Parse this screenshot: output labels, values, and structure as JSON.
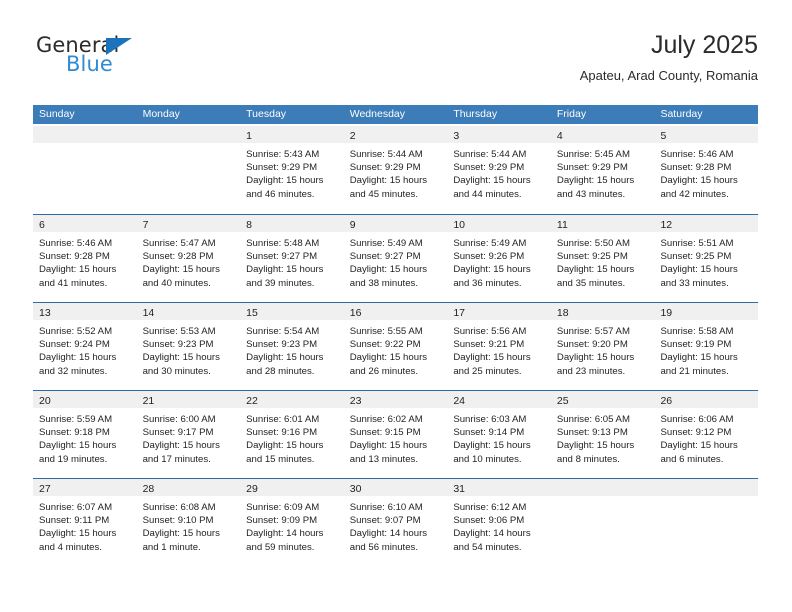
{
  "brand": {
    "name_top": "General",
    "name_bottom": "Blue",
    "triangle_color": "#1b74bb",
    "blue_text_color": "#2e8bd4"
  },
  "header": {
    "title": "July 2025",
    "subtitle": "Apateu, Arad County, Romania"
  },
  "theme": {
    "header_band": "#3b7cb9",
    "row_separator": "#2d6ca6",
    "day_number_band": "#f0f0f0",
    "text": "#231f20"
  },
  "weekdays": [
    "Sunday",
    "Monday",
    "Tuesday",
    "Wednesday",
    "Thursday",
    "Friday",
    "Saturday"
  ],
  "weeks": [
    [
      {
        "day": "",
        "lines": []
      },
      {
        "day": "",
        "lines": []
      },
      {
        "day": "1",
        "lines": [
          "Sunrise: 5:43 AM",
          "Sunset: 9:29 PM",
          "Daylight: 15 hours",
          "and 46 minutes."
        ]
      },
      {
        "day": "2",
        "lines": [
          "Sunrise: 5:44 AM",
          "Sunset: 9:29 PM",
          "Daylight: 15 hours",
          "and 45 minutes."
        ]
      },
      {
        "day": "3",
        "lines": [
          "Sunrise: 5:44 AM",
          "Sunset: 9:29 PM",
          "Daylight: 15 hours",
          "and 44 minutes."
        ]
      },
      {
        "day": "4",
        "lines": [
          "Sunrise: 5:45 AM",
          "Sunset: 9:29 PM",
          "Daylight: 15 hours",
          "and 43 minutes."
        ]
      },
      {
        "day": "5",
        "lines": [
          "Sunrise: 5:46 AM",
          "Sunset: 9:28 PM",
          "Daylight: 15 hours",
          "and 42 minutes."
        ]
      }
    ],
    [
      {
        "day": "6",
        "lines": [
          "Sunrise: 5:46 AM",
          "Sunset: 9:28 PM",
          "Daylight: 15 hours",
          "and 41 minutes."
        ]
      },
      {
        "day": "7",
        "lines": [
          "Sunrise: 5:47 AM",
          "Sunset: 9:28 PM",
          "Daylight: 15 hours",
          "and 40 minutes."
        ]
      },
      {
        "day": "8",
        "lines": [
          "Sunrise: 5:48 AM",
          "Sunset: 9:27 PM",
          "Daylight: 15 hours",
          "and 39 minutes."
        ]
      },
      {
        "day": "9",
        "lines": [
          "Sunrise: 5:49 AM",
          "Sunset: 9:27 PM",
          "Daylight: 15 hours",
          "and 38 minutes."
        ]
      },
      {
        "day": "10",
        "lines": [
          "Sunrise: 5:49 AM",
          "Sunset: 9:26 PM",
          "Daylight: 15 hours",
          "and 36 minutes."
        ]
      },
      {
        "day": "11",
        "lines": [
          "Sunrise: 5:50 AM",
          "Sunset: 9:25 PM",
          "Daylight: 15 hours",
          "and 35 minutes."
        ]
      },
      {
        "day": "12",
        "lines": [
          "Sunrise: 5:51 AM",
          "Sunset: 9:25 PM",
          "Daylight: 15 hours",
          "and 33 minutes."
        ]
      }
    ],
    [
      {
        "day": "13",
        "lines": [
          "Sunrise: 5:52 AM",
          "Sunset: 9:24 PM",
          "Daylight: 15 hours",
          "and 32 minutes."
        ]
      },
      {
        "day": "14",
        "lines": [
          "Sunrise: 5:53 AM",
          "Sunset: 9:23 PM",
          "Daylight: 15 hours",
          "and 30 minutes."
        ]
      },
      {
        "day": "15",
        "lines": [
          "Sunrise: 5:54 AM",
          "Sunset: 9:23 PM",
          "Daylight: 15 hours",
          "and 28 minutes."
        ]
      },
      {
        "day": "16",
        "lines": [
          "Sunrise: 5:55 AM",
          "Sunset: 9:22 PM",
          "Daylight: 15 hours",
          "and 26 minutes."
        ]
      },
      {
        "day": "17",
        "lines": [
          "Sunrise: 5:56 AM",
          "Sunset: 9:21 PM",
          "Daylight: 15 hours",
          "and 25 minutes."
        ]
      },
      {
        "day": "18",
        "lines": [
          "Sunrise: 5:57 AM",
          "Sunset: 9:20 PM",
          "Daylight: 15 hours",
          "and 23 minutes."
        ]
      },
      {
        "day": "19",
        "lines": [
          "Sunrise: 5:58 AM",
          "Sunset: 9:19 PM",
          "Daylight: 15 hours",
          "and 21 minutes."
        ]
      }
    ],
    [
      {
        "day": "20",
        "lines": [
          "Sunrise: 5:59 AM",
          "Sunset: 9:18 PM",
          "Daylight: 15 hours",
          "and 19 minutes."
        ]
      },
      {
        "day": "21",
        "lines": [
          "Sunrise: 6:00 AM",
          "Sunset: 9:17 PM",
          "Daylight: 15 hours",
          "and 17 minutes."
        ]
      },
      {
        "day": "22",
        "lines": [
          "Sunrise: 6:01 AM",
          "Sunset: 9:16 PM",
          "Daylight: 15 hours",
          "and 15 minutes."
        ]
      },
      {
        "day": "23",
        "lines": [
          "Sunrise: 6:02 AM",
          "Sunset: 9:15 PM",
          "Daylight: 15 hours",
          "and 13 minutes."
        ]
      },
      {
        "day": "24",
        "lines": [
          "Sunrise: 6:03 AM",
          "Sunset: 9:14 PM",
          "Daylight: 15 hours",
          "and 10 minutes."
        ]
      },
      {
        "day": "25",
        "lines": [
          "Sunrise: 6:05 AM",
          "Sunset: 9:13 PM",
          "Daylight: 15 hours",
          "and 8 minutes."
        ]
      },
      {
        "day": "26",
        "lines": [
          "Sunrise: 6:06 AM",
          "Sunset: 9:12 PM",
          "Daylight: 15 hours",
          "and 6 minutes."
        ]
      }
    ],
    [
      {
        "day": "27",
        "lines": [
          "Sunrise: 6:07 AM",
          "Sunset: 9:11 PM",
          "Daylight: 15 hours",
          "and 4 minutes."
        ]
      },
      {
        "day": "28",
        "lines": [
          "Sunrise: 6:08 AM",
          "Sunset: 9:10 PM",
          "Daylight: 15 hours",
          "and 1 minute."
        ]
      },
      {
        "day": "29",
        "lines": [
          "Sunrise: 6:09 AM",
          "Sunset: 9:09 PM",
          "Daylight: 14 hours",
          "and 59 minutes."
        ]
      },
      {
        "day": "30",
        "lines": [
          "Sunrise: 6:10 AM",
          "Sunset: 9:07 PM",
          "Daylight: 14 hours",
          "and 56 minutes."
        ]
      },
      {
        "day": "31",
        "lines": [
          "Sunrise: 6:12 AM",
          "Sunset: 9:06 PM",
          "Daylight: 14 hours",
          "and 54 minutes."
        ]
      },
      {
        "day": "",
        "lines": []
      },
      {
        "day": "",
        "lines": []
      }
    ]
  ]
}
